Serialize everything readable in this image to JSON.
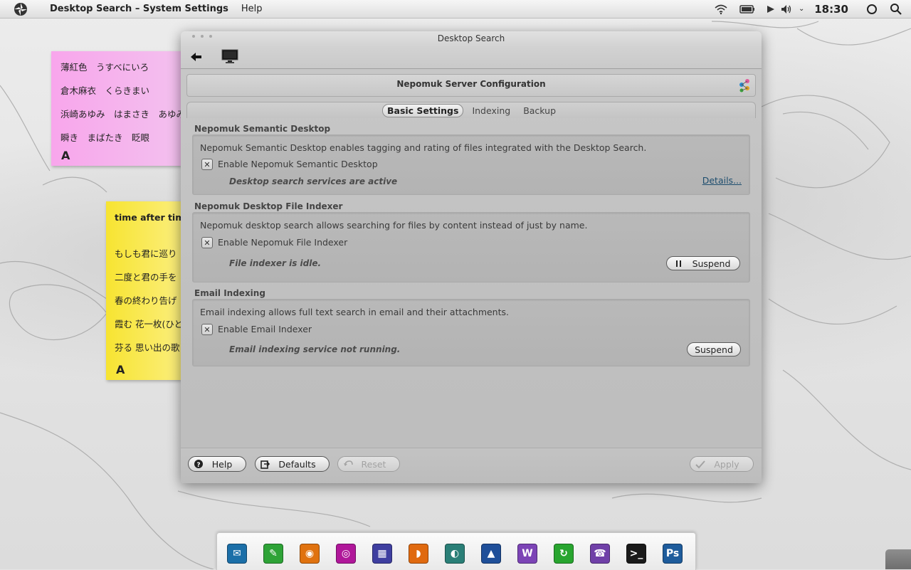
{
  "top_panel": {
    "app_title": "Desktop Search – System Settings",
    "menu_help": "Help",
    "clock": "18:30",
    "icons": [
      "app-logo-icon",
      "wifi-icon",
      "battery-icon",
      "media-play-icon",
      "volume-icon",
      "chevron-down-icon",
      "power-icon",
      "search-icon"
    ]
  },
  "notes": {
    "pink": {
      "lines": [
        "薄紅色　うすべにいろ",
        "倉木麻衣　くらきまい",
        "浜崎あゆみ　はまさき　あゆみ",
        "瞬き　まばたき　眨眼"
      ],
      "font_badge": "A"
    },
    "yellow": {
      "title": "time after time",
      "lines": [
        "もしも君に巡り",
        "二度と君の手を",
        "春の終わり告げ",
        "霞む 花一枚(ひと",
        "芬る 思い出の歌"
      ],
      "font_badge": "A"
    }
  },
  "window": {
    "title": "Desktop Search",
    "page_title": "Nepomuk Server Configuration",
    "tabs": [
      {
        "label": "Basic Settings",
        "active": true
      },
      {
        "label": "Indexing",
        "active": false
      },
      {
        "label": "Backup",
        "active": false
      }
    ],
    "sections": {
      "semantic": {
        "title": "Nepomuk Semantic Desktop",
        "description": "Nepomuk Semantic Desktop enables tagging and rating of files integrated with the Desktop Search.",
        "checkbox_label": "Enable Nepomuk Semantic Desktop",
        "checkbox_mark": "✕",
        "status": "Desktop search services are active",
        "link": "Details..."
      },
      "indexer": {
        "title": "Nepomuk Desktop File Indexer",
        "description": "Nepomuk desktop search allows searching for files by content instead of just by name.",
        "checkbox_label": "Enable Nepomuk File Indexer",
        "checkbox_mark": "✕",
        "status": "File indexer is idle.",
        "button": "Suspend"
      },
      "email": {
        "title": "Email Indexing",
        "description": "Email indexing allows full text search in email and their attachments.",
        "checkbox_label": "Enable Email Indexer",
        "checkbox_mark": "✕",
        "status": "Email indexing service not running.",
        "button": "Suspend"
      }
    },
    "bottom_buttons": {
      "help": "Help",
      "defaults": "Defaults",
      "reset": "Reset",
      "apply": "Apply"
    }
  },
  "dock": {
    "items": [
      {
        "name": "thunderbird-icon",
        "color": "#1c6fa8",
        "glyph": "✉"
      },
      {
        "name": "evernote-icon",
        "color": "#2ea337",
        "glyph": "✎"
      },
      {
        "name": "firefox-icon",
        "color": "#e0720f",
        "glyph": "◉"
      },
      {
        "name": "music-player-icon",
        "color": "#b0179a",
        "glyph": "◎"
      },
      {
        "name": "video-editor-icon",
        "color": "#3f3fa0",
        "glyph": "▦"
      },
      {
        "name": "rss-reader-icon",
        "color": "#e06a10",
        "glyph": "◗"
      },
      {
        "name": "browser-icon",
        "color": "#2a7f77",
        "glyph": "◐"
      },
      {
        "name": "cat-app-icon",
        "color": "#1f4f99",
        "glyph": "▲"
      },
      {
        "name": "wordpress-icon",
        "color": "#7c44b6",
        "glyph": "W"
      },
      {
        "name": "refresh-app-icon",
        "color": "#28a52f",
        "glyph": "↻"
      },
      {
        "name": "phone-app-icon",
        "color": "#7040a8",
        "glyph": "☎"
      },
      {
        "name": "terminal-icon",
        "color": "#1a1a1a",
        "glyph": ">_"
      },
      {
        "name": "photoshop-icon",
        "color": "#1e5c9c",
        "glyph": "Ps"
      }
    ]
  }
}
